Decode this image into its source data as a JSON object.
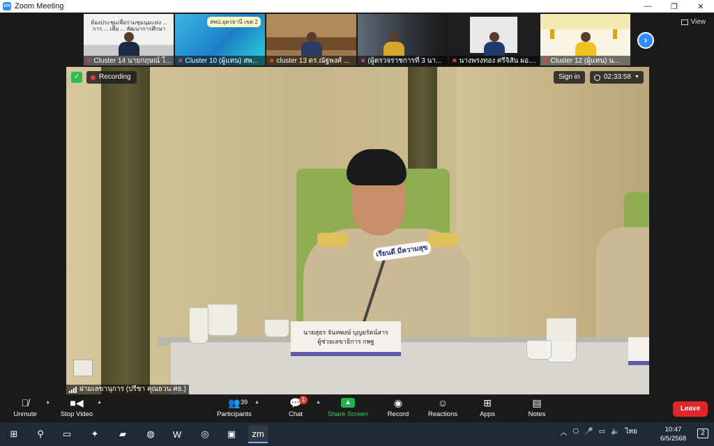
{
  "window": {
    "title": "Zoom Meeting",
    "app_icon": "zm",
    "minimize": "—",
    "restore": "❐",
    "close": "✕"
  },
  "thumbnails": [
    {
      "label": "Cluster 14 นายกฤษณ์ โ...",
      "banner": "ห้องประชุมเพื่อร่วมชุมนุมแห่ง ... การ ... เพื่อ ... พัฒนาการศึกษา ...",
      "muted": true
    },
    {
      "label": "Cluster 10 (ผู้แทน) สพ...",
      "banner": "สพป.อุดรธานี เขต 2",
      "muted": true
    },
    {
      "label": "cluster 13 ดร.ณัฐพงศ์ ...",
      "muted": true
    },
    {
      "label": "(ผู้ตรวจราชการที่ 3 นา...",
      "muted": true
    },
    {
      "label": "นางพรงทอง ศรีจิสัน ผอ....",
      "muted": true
    },
    {
      "label": "Cluster 12 (ผู้แทน) น...",
      "muted": true
    }
  ],
  "strip_next": "›",
  "view_label": "View",
  "overlays": {
    "recording_label": "Recording",
    "signin_label": "Sign in",
    "timer": "02:33:58",
    "main_speaker_label": "ฝามเลขานุการ (ปรีชา คุณธวน ศธ.)",
    "nameplate_line1": "นายสุธร จันทพงษ์ บุญยรัตน์สาร",
    "nameplate_line2": "ผู้ช่วยเลขาธิการ กพฐ",
    "mic_sticker": "เรียนดี มีความสุข"
  },
  "toolbar": {
    "unmute": "Unmute",
    "stop_video": "Stop Video",
    "participants": "Participants",
    "participants_count": "39",
    "chat": "Chat",
    "chat_badge": "1",
    "share_screen": "Share Screen",
    "record": "Record",
    "reactions": "Reactions",
    "apps": "Apps",
    "notes": "Notes",
    "leave": "Leave"
  },
  "taskbar": {
    "language": "ไทย",
    "time": "10:47",
    "date": "6/5/2568",
    "notifications": "2"
  }
}
